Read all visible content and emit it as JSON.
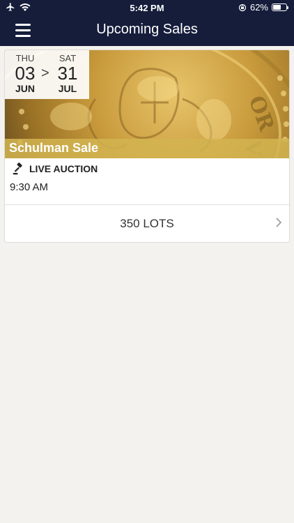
{
  "status_bar": {
    "time": "5:42 PM",
    "battery_percent": "62%",
    "battery_level": 0.62,
    "icons": [
      "airplane-icon",
      "wifi-icon",
      "orientation-lock-icon",
      "battery-icon"
    ]
  },
  "nav": {
    "title": "Upcoming Sales",
    "menu_icon": "hamburger-menu-icon"
  },
  "sale": {
    "start": {
      "dow": "THU",
      "day": "03",
      "month": "JUN"
    },
    "separator": ">",
    "end": {
      "dow": "SAT",
      "day": "31",
      "month": "JUL"
    },
    "name": "Schulman Sale",
    "auction_type": "LIVE AUCTION",
    "time": "9:30 AM",
    "lots": "350 LOTS",
    "image": "gold-coin-image"
  },
  "colors": {
    "nav_bg": "#151d3b",
    "page_bg": "#f4f2ee",
    "banner_gold": "#d2b450"
  }
}
